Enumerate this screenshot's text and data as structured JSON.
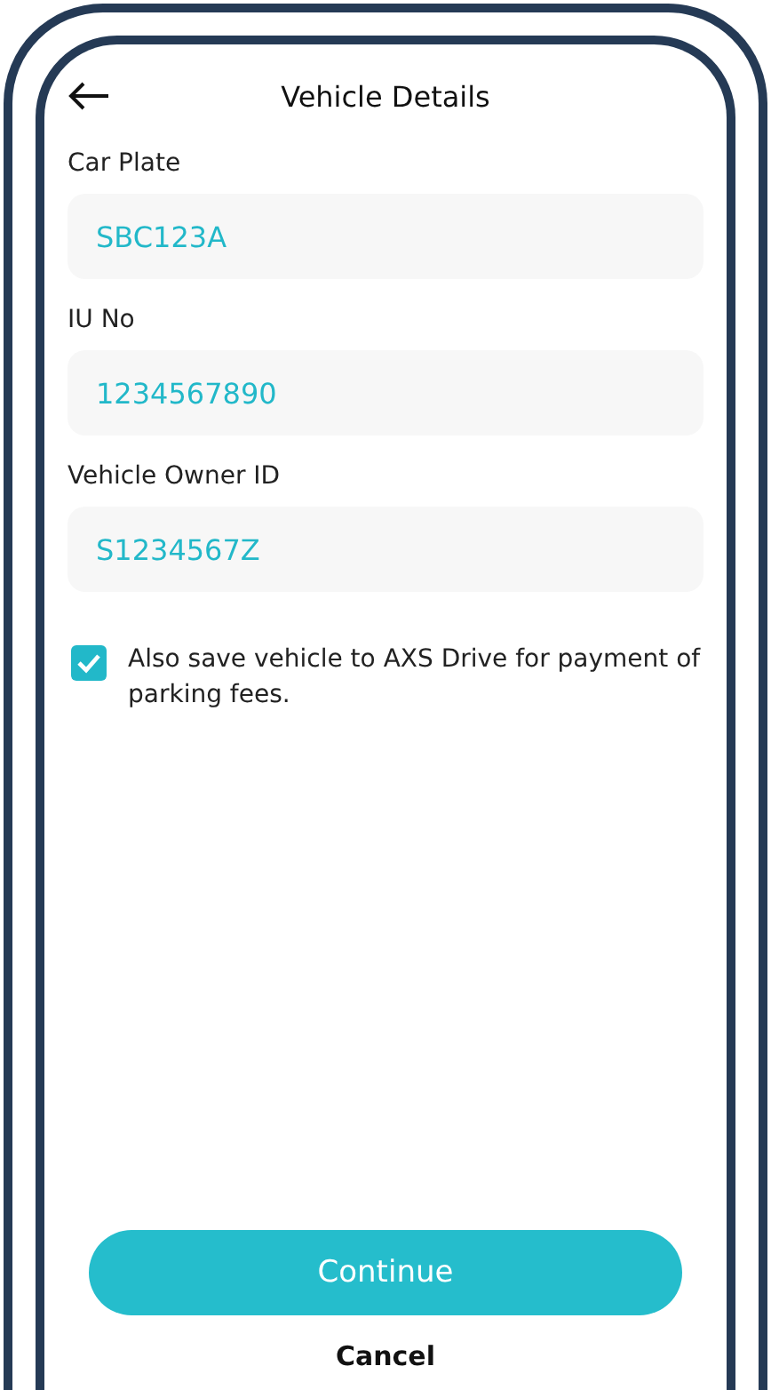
{
  "header": {
    "title": "Vehicle Details"
  },
  "fields": [
    {
      "label": "Car Plate",
      "value": "SBC123A"
    },
    {
      "label": "IU No",
      "value": "1234567890"
    },
    {
      "label": "Vehicle Owner ID",
      "value": "S1234567Z"
    }
  ],
  "save_option": {
    "text": "Also save vehicle to AXS Drive for payment of parking fees.",
    "checked": true
  },
  "buttons": {
    "primary": "Continue",
    "secondary": "Cancel"
  }
}
